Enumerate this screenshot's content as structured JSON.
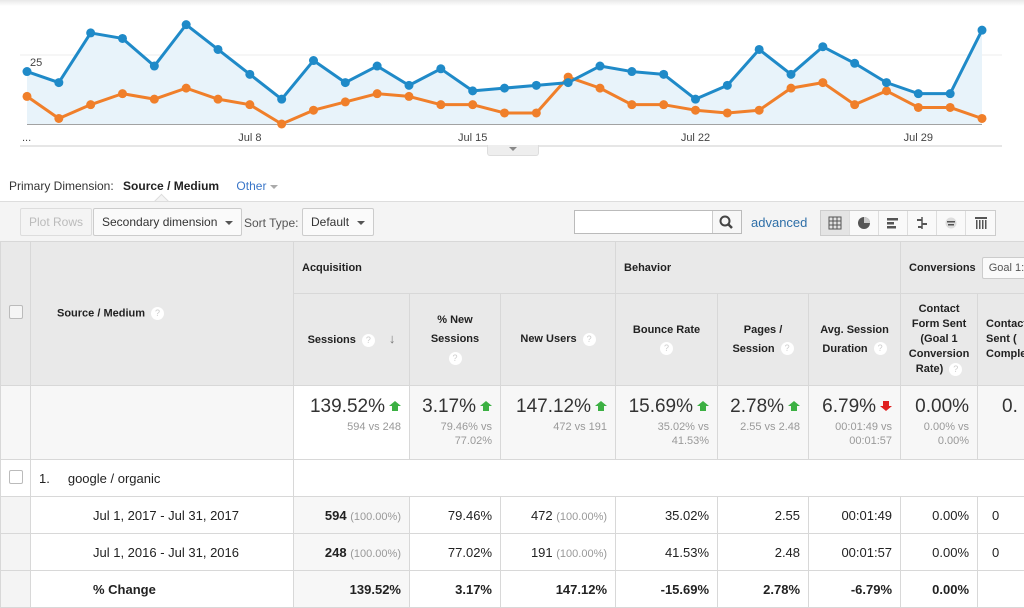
{
  "chart_data": {
    "type": "line",
    "title": "",
    "y_gridline_label": "25",
    "ylim": [
      0,
      45
    ],
    "x_tick_labels": [
      "...",
      "Jul 8",
      "Jul 15",
      "Jul 22",
      "Jul 29"
    ],
    "x": [
      "Jul 1",
      "Jul 2",
      "Jul 3",
      "Jul 4",
      "Jul 5",
      "Jul 6",
      "Jul 7",
      "Jul 8",
      "Jul 9",
      "Jul 10",
      "Jul 11",
      "Jul 12",
      "Jul 13",
      "Jul 14",
      "Jul 15",
      "Jul 16",
      "Jul 17",
      "Jul 18",
      "Jul 19",
      "Jul 20",
      "Jul 21",
      "Jul 22",
      "Jul 23",
      "Jul 24",
      "Jul 25",
      "Jul 26",
      "Jul 27",
      "Jul 28",
      "Jul 29",
      "Jul 30",
      "Jul 31"
    ],
    "series": [
      {
        "name": "Jul 1, 2017 - Jul 31, 2017",
        "color": "#1f8ac8",
        "values": [
          19,
          15,
          33,
          31,
          21,
          36,
          27,
          18,
          9,
          23,
          15,
          21,
          14,
          20,
          12,
          13,
          14,
          15,
          21,
          19,
          18,
          9,
          14,
          27,
          18,
          28,
          22,
          15,
          11,
          11,
          34
        ]
      },
      {
        "name": "Jul 1, 2016 - Jul 31, 2016",
        "color": "#f07f2a",
        "values": [
          10,
          2,
          7,
          11,
          9,
          13,
          9,
          7,
          0,
          5,
          8,
          11,
          10,
          7,
          7,
          4,
          4,
          17,
          13,
          7,
          7,
          5,
          4,
          5,
          13,
          15,
          7,
          12,
          6,
          6,
          2
        ]
      }
    ],
    "grid": true,
    "legend": "none"
  },
  "primary_dimension": {
    "label": "Primary Dimension:",
    "value": "Source / Medium",
    "other": "Other"
  },
  "toolbar": {
    "plot_rows": "Plot Rows",
    "secondary_dimension": "Secondary dimension",
    "sort_type_label": "Sort Type:",
    "sort_type_value": "Default",
    "search_value": "",
    "advanced": "advanced"
  },
  "table": {
    "dimension_header": "Source / Medium",
    "groups": {
      "acquisition": "Acquisition",
      "behavior": "Behavior",
      "conversions": "Conversions",
      "goal_select": "Goal 1:"
    },
    "columns": {
      "sessions": "Sessions",
      "new_sessions_1": "% New",
      "new_sessions_2": "Sessions",
      "new_users": "New Users",
      "bounce_rate": "Bounce Rate",
      "pages_1": "Pages /",
      "pages_2": "Session",
      "duration_1": "Avg. Session",
      "duration_2": "Duration",
      "conv_rate_1": "Contact",
      "conv_rate_2": "Form Sent",
      "conv_rate_3": "(Goal 1",
      "conv_rate_4": "Conversion",
      "conv_rate_5": "Rate)",
      "completions_1": "Contact",
      "completions_2": "Sent (",
      "completions_3": "Comple"
    },
    "summary": {
      "sessions": {
        "change": "139.52%",
        "compare": "594 vs 248",
        "dir": "up"
      },
      "new_sessions": {
        "change": "3.17%",
        "compare_1": "79.46% vs",
        "compare_2": "77.02%",
        "dir": "up"
      },
      "new_users": {
        "change": "147.12%",
        "compare": "472 vs 191",
        "dir": "up"
      },
      "bounce_rate": {
        "change": "15.69%",
        "compare_1": "35.02% vs",
        "compare_2": "41.53%",
        "dir": "up"
      },
      "pages": {
        "change": "2.78%",
        "compare": "2.55 vs 2.48",
        "dir": "up"
      },
      "duration": {
        "change": "6.79%",
        "compare_1": "00:01:49 vs",
        "compare_2": "00:01:57",
        "dir": "down"
      },
      "conv_rate": {
        "change": "0.00%",
        "compare_1": "0.00% vs",
        "compare_2": "0.00%"
      },
      "completions": {
        "change": "0."
      }
    },
    "row": {
      "index": "1.",
      "name": "google / organic",
      "periods": [
        {
          "label": "Jul 1, 2017 - Jul 31, 2017",
          "sessions": "594",
          "sessions_pct": "(100.00%)",
          "new_sessions": "79.46%",
          "new_users": "472",
          "new_users_pct": "(100.00%)",
          "bounce_rate": "35.02%",
          "pages": "2.55",
          "duration": "00:01:49",
          "conv_rate": "0.00%",
          "completions": "0"
        },
        {
          "label": "Jul 1, 2016 - Jul 31, 2016",
          "sessions": "248",
          "sessions_pct": "(100.00%)",
          "new_sessions": "77.02%",
          "new_users": "191",
          "new_users_pct": "(100.00%)",
          "bounce_rate": "41.53%",
          "pages": "2.48",
          "duration": "00:01:57",
          "conv_rate": "0.00%",
          "completions": "0"
        }
      ],
      "change": {
        "label": "% Change",
        "sessions": "139.52%",
        "new_sessions": "3.17%",
        "new_users": "147.12%",
        "bounce_rate": "-15.69%",
        "pages": "2.78%",
        "duration": "-6.79%",
        "conv_rate": "0.00%",
        "completions": ""
      }
    }
  }
}
